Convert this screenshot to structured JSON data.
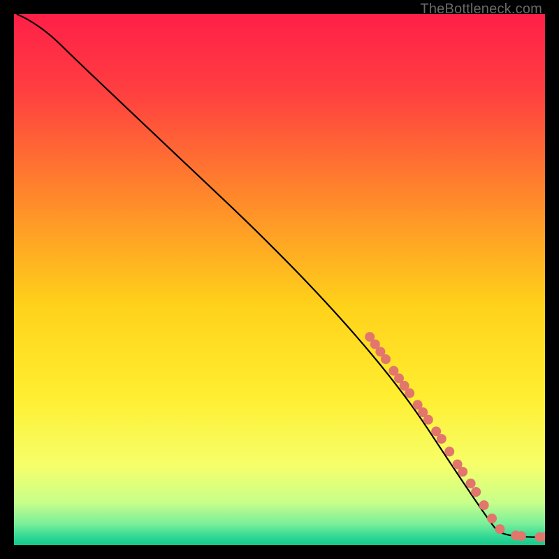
{
  "watermark": "TheBottleneck.com",
  "chart_data": {
    "type": "line",
    "title": "",
    "xlabel": "",
    "ylabel": "",
    "xlim": [
      0,
      100
    ],
    "ylim": [
      0,
      100
    ],
    "grid": false,
    "gradient_stops": [
      {
        "offset": 0,
        "color": "#ff1f48"
      },
      {
        "offset": 15,
        "color": "#ff4040"
      },
      {
        "offset": 35,
        "color": "#ff8a2a"
      },
      {
        "offset": 55,
        "color": "#ffd21a"
      },
      {
        "offset": 72,
        "color": "#ffee30"
      },
      {
        "offset": 85,
        "color": "#f6ff6a"
      },
      {
        "offset": 92,
        "color": "#c8ff8a"
      },
      {
        "offset": 96,
        "color": "#7aef9a"
      },
      {
        "offset": 98.5,
        "color": "#2fd895"
      },
      {
        "offset": 100,
        "color": "#12c98c"
      }
    ],
    "series": [
      {
        "name": "curve",
        "points": [
          {
            "x": 0.5,
            "y": 100.0
          },
          {
            "x": 3.0,
            "y": 98.8
          },
          {
            "x": 7.0,
            "y": 96.0
          },
          {
            "x": 12.0,
            "y": 91.0
          },
          {
            "x": 66.0,
            "y": 40.0
          },
          {
            "x": 90.0,
            "y": 3.5
          },
          {
            "x": 92.0,
            "y": 2.0
          },
          {
            "x": 96.0,
            "y": 1.5
          },
          {
            "x": 99.5,
            "y": 1.5
          }
        ]
      }
    ],
    "markers": [
      {
        "x": 67.0,
        "y": 39.2
      },
      {
        "x": 68.0,
        "y": 37.8
      },
      {
        "x": 69.0,
        "y": 36.4
      },
      {
        "x": 70.0,
        "y": 35.0
      },
      {
        "x": 71.5,
        "y": 32.8
      },
      {
        "x": 72.5,
        "y": 31.4
      },
      {
        "x": 73.5,
        "y": 30.0
      },
      {
        "x": 74.5,
        "y": 28.6
      },
      {
        "x": 76.0,
        "y": 26.4
      },
      {
        "x": 77.0,
        "y": 25.0
      },
      {
        "x": 78.0,
        "y": 23.6
      },
      {
        "x": 79.5,
        "y": 21.4
      },
      {
        "x": 80.5,
        "y": 20.0
      },
      {
        "x": 82.0,
        "y": 17.6
      },
      {
        "x": 83.5,
        "y": 15.2
      },
      {
        "x": 84.5,
        "y": 13.8
      },
      {
        "x": 86.0,
        "y": 11.6
      },
      {
        "x": 87.0,
        "y": 10.0
      },
      {
        "x": 88.5,
        "y": 7.5
      },
      {
        "x": 90.0,
        "y": 5.0
      },
      {
        "x": 91.5,
        "y": 3.0
      },
      {
        "x": 94.5,
        "y": 1.8
      },
      {
        "x": 95.5,
        "y": 1.7
      },
      {
        "x": 99.0,
        "y": 1.5
      },
      {
        "x": 100.0,
        "y": 1.5
      }
    ],
    "marker_style": {
      "radius_px": 7,
      "fill": "#e2766c"
    }
  }
}
